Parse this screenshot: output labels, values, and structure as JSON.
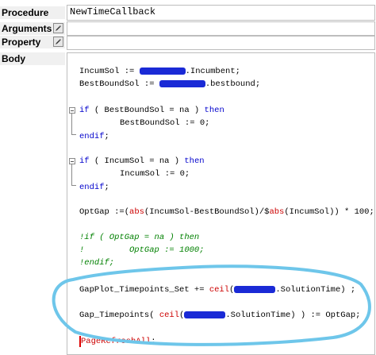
{
  "labels": {
    "procedure": "Procedure",
    "arguments": "Arguments",
    "property": "Property",
    "body": "Body"
  },
  "fields": {
    "procedure_value": "NewTimeCallback",
    "arguments_value": "",
    "property_value": ""
  },
  "code": {
    "l1_a": "IncumSol := ",
    "l1_b": ".Incumbent;",
    "l2_a": "BestBoundSol := ",
    "l2_b": ".bestbound;",
    "l3_kw1": "if",
    "l3_mid": " ( BestBoundSol = na ) ",
    "l3_kw2": "then",
    "l4": "BestBoundSol := 0;",
    "l5_kw": "endif",
    "l5_tail": ";",
    "l6_kw1": "if",
    "l6_mid": " ( IncumSol = na ) ",
    "l6_kw2": "then",
    "l7": "IncumSol := 0;",
    "l8_kw": "endif",
    "l8_tail": ";",
    "l9_a": "OptGap :=(",
    "l9_fn1": "abs",
    "l9_b": "(IncumSol-BestBoundSol)/$",
    "l9_fn2": "abs",
    "l9_c": "(IncumSol)) * 100;",
    "c1": "!if ( OptGap = na ) then",
    "c2": "!         OptGap := 1000;",
    "c3": "!endif;",
    "l10_a": "GapPlot_Timepoints_Set += ",
    "l10_fn": "ceil",
    "l10_b": "(",
    "l10_c": ".SolutionTime) ;",
    "l11_a": "Gap_Timepoints( ",
    "l11_fn": "ceil",
    "l11_b": "(",
    "l11_c": ".SolutionTime) ) := OptGap;",
    "l12_fn": "PageRefreshAll",
    "l12_tail": ";"
  },
  "icons": {
    "edit": "pencil-icon",
    "fold": "fold-toggle-icon",
    "annotation": "hand-drawn-ellipse"
  },
  "colors": {
    "keyword": "#0000cc",
    "function": "#cc0000",
    "comment": "#008000",
    "redaction": "#1a2ad6",
    "annotation": "#6ec6ea"
  }
}
